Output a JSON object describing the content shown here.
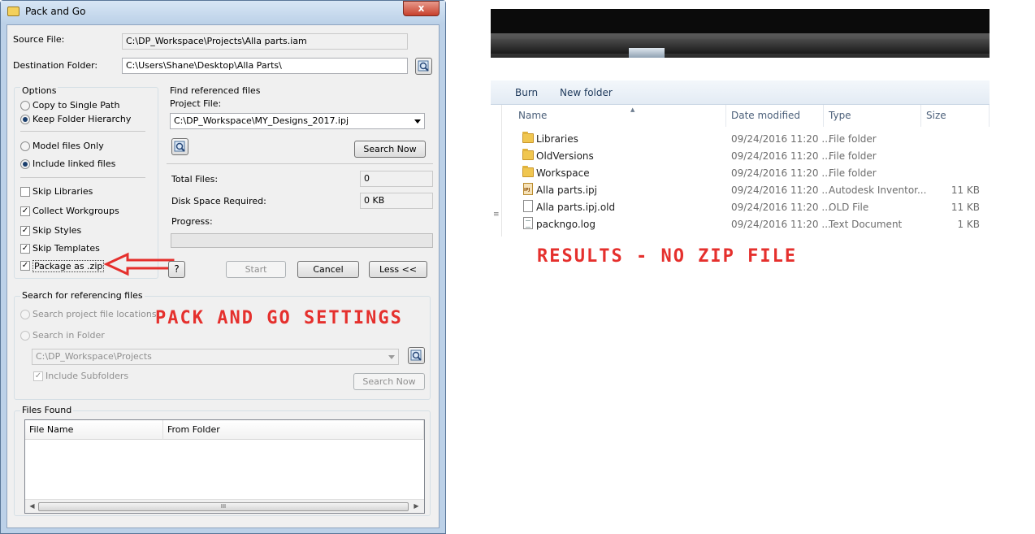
{
  "dialog": {
    "title": "Pack and Go",
    "close_glyph": "x",
    "source_label": "Source File:",
    "source_value": "C:\\DP_Workspace\\Projects\\Alla parts.iam",
    "dest_label": "Destination Folder:",
    "dest_value": "C:\\Users\\Shane\\Desktop\\Alla Parts\\",
    "options": {
      "title": "Options",
      "copy_single": "Copy to Single Path",
      "keep_hierarchy": "Keep Folder Hierarchy",
      "model_only": "Model files Only",
      "include_linked": "Include linked files",
      "skip_libraries": "Skip Libraries",
      "collect_workgroups": "Collect Workgroups",
      "skip_styles": "Skip Styles",
      "skip_templates": "Skip Templates",
      "package_zip": "Package as .zip"
    },
    "find": {
      "title": "Find referenced files",
      "project_label": "Project File:",
      "project_value": "C:\\DP_Workspace\\MY_Designs_2017.ipj",
      "search_now": "Search Now",
      "total_files_label": "Total Files:",
      "total_files_value": "0",
      "disk_space_label": "Disk Space Required:",
      "disk_space_value": "0 KB",
      "progress_label": "Progress:",
      "progress": 0
    },
    "buttons": {
      "help": "?",
      "start": "Start",
      "cancel": "Cancel",
      "less": "Less <<"
    },
    "referencing": {
      "title": "Search for referencing files",
      "project_locations": "Search project file locations",
      "in_folder": "Search in Folder",
      "folder_value": "C:\\DP_Workspace\\Projects",
      "include_subfolders": "Include Subfolders",
      "search_now": "Search Now"
    },
    "files_found": {
      "title": "Files Found",
      "columns": [
        "File Name",
        "From Folder"
      ],
      "scroll_grip": "III"
    }
  },
  "annotations": {
    "settings": "PACK AND GO SETTINGS",
    "results": "RESULTS - NO ZIP FILE",
    "color": "#e5302d"
  },
  "explorer": {
    "toolbar": [
      "Burn",
      "New folder"
    ],
    "columns": [
      "Name",
      "Date modified",
      "Type",
      "Size"
    ],
    "left_grip": "≡",
    "rows": [
      {
        "icon": "folder-icon",
        "name": "Libraries",
        "date": "09/24/2016 11:20 ...",
        "type": "File folder",
        "size": ""
      },
      {
        "icon": "folder-icon",
        "name": "OldVersions",
        "date": "09/24/2016 11:20 ...",
        "type": "File folder",
        "size": ""
      },
      {
        "icon": "folder-icon",
        "name": "Workspace",
        "date": "09/24/2016 11:20 ...",
        "type": "File folder",
        "size": ""
      },
      {
        "icon": "ipj-file-icon",
        "name": "Alla parts.ipj",
        "date": "09/24/2016 11:20 ...",
        "type": "Autodesk Inventor...",
        "size": "11 KB"
      },
      {
        "icon": "file-icon",
        "name": "Alla parts.ipj.old",
        "date": "09/24/2016 11:20 ...",
        "type": "OLD File",
        "size": "11 KB"
      },
      {
        "icon": "text-file-icon",
        "name": "packngo.log",
        "date": "09/24/2016 11:20 ...",
        "type": "Text Document",
        "size": "1 KB"
      }
    ]
  }
}
